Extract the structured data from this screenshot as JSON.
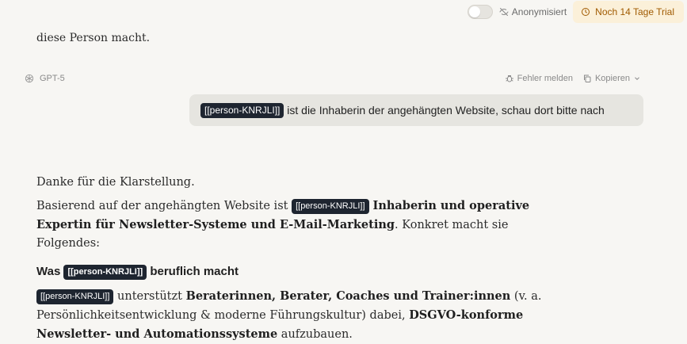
{
  "topbar": {
    "anon_label": "Anonymisiert",
    "trial_label": "Noch 14 Tage Trial"
  },
  "conversation": {
    "prev_text_tail": "diese Person macht.",
    "model_label": "GPT-5",
    "report_label": "Fehler melden",
    "copy_label": "Kopieren",
    "user_message": {
      "tag": "[[person-KNRJLI]]",
      "text": " ist die Inhaberin der angehängten Website, schau dort bitte nach"
    },
    "answer": {
      "p1": "Danke für die Klarstellung.",
      "p2_a": "Basierend auf der angehängten Website ist ",
      "p2_tag": "[[person-KNRJLI]]",
      "p2_b": " Inhaberin und operative Expertin für Newsletter-Systeme und E-Mail-Marketing",
      "p2_c": ". Konkret macht sie Folgendes:",
      "h_a": "Was ",
      "h_tag": "[[person-KNRJLI]]",
      "h_b": " beruflich macht",
      "p3_tag": "[[person-KNRJLI]]",
      "p3_a": " unterstützt ",
      "p3_b": "Beraterinnen, Berater, Coaches und Trainer:innen",
      "p3_c": " (v. a. Persönlichkeitsentwicklung & moderne Führungskultur) dabei, ",
      "p3_d": "DSGVO-konforme Newsletter- und Automationssysteme",
      "p3_e": " aufzubauen."
    }
  },
  "colors": {
    "background": "#f7f6f3",
    "tag_bg": "#1e2530",
    "trial_bg": "#fbf0d9",
    "trial_fg": "#a05a00",
    "bubble_bg": "#e6e5e0"
  },
  "icons": [
    "eye-off-icon",
    "clock-icon",
    "openai-logo-icon",
    "bug-icon",
    "copy-icon",
    "chevron-down-icon"
  ]
}
